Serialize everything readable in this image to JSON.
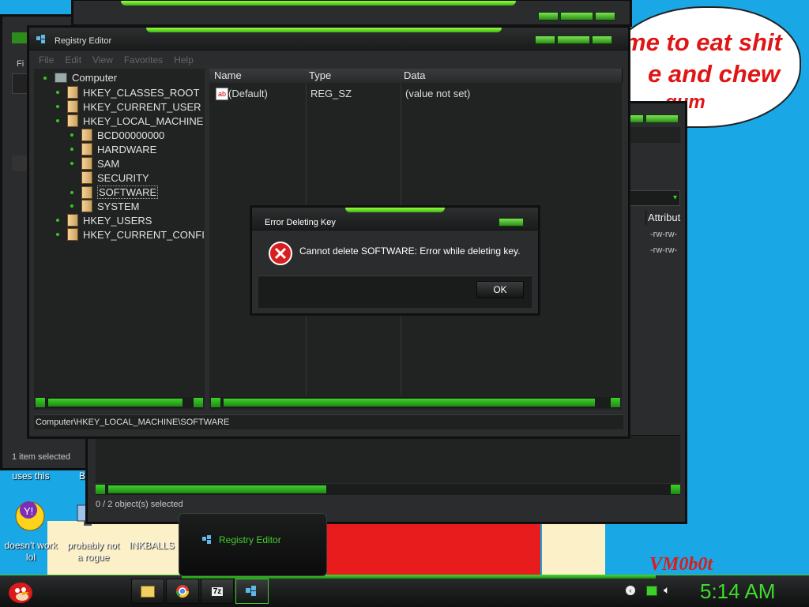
{
  "wallpaper": {
    "bubble_line1": "me to eat shit",
    "bubble_line2": "e and chew",
    "bubble_line3": "gum",
    "signature": "VM0b0t"
  },
  "desktop_icons": [
    {
      "label": "uses this"
    },
    {
      "label": "B"
    },
    {
      "label": "doesn't work lol"
    },
    {
      "label": "probably not a rogue"
    },
    {
      "label": "INKBALLS"
    }
  ],
  "back_window_left": {
    "menu_fragment": "Fi",
    "status": "1 item selected"
  },
  "back_window_right": {
    "column_attributes": "Attribut",
    "rows": [
      {
        "attributes": "-rw-rw-"
      },
      {
        "attributes": "-rw-rw-"
      }
    ],
    "status": "0 / 2 object(s) selected"
  },
  "registry": {
    "title": "Registry Editor",
    "menu": [
      "File",
      "Edit",
      "View",
      "Favorites",
      "Help"
    ],
    "tree": {
      "root": "Computer",
      "hives": [
        "HKEY_CLASSES_ROOT",
        "HKEY_CURRENT_USER",
        "HKEY_LOCAL_MACHINE",
        "HKEY_USERS",
        "HKEY_CURRENT_CONFI"
      ],
      "hklm_children": [
        "BCD00000000",
        "HARDWARE",
        "SAM",
        "SECURITY",
        "SOFTWARE",
        "SYSTEM"
      ],
      "selected": "SOFTWARE"
    },
    "columns": {
      "name": "Name",
      "type": "Type",
      "data": "Data"
    },
    "values": [
      {
        "name": "(Default)",
        "type": "REG_SZ",
        "data": "(value not set)",
        "icon": "ab-icon"
      }
    ],
    "status_path": "Computer\\HKEY_LOCAL_MACHINE\\SOFTWARE"
  },
  "dialog": {
    "title": "Error Deleting Key",
    "message": "Cannot delete SOFTWARE:  Error while deleting key.",
    "ok": "OK",
    "icon": "error-icon"
  },
  "taskbar": {
    "start_icon": "angry-bird-icon",
    "pinned": [
      {
        "icon": "folder-icon"
      },
      {
        "icon": "chrome-icon"
      },
      {
        "icon": "7zip-icon",
        "text": "7z"
      },
      {
        "icon": "registry-icon"
      }
    ],
    "preview_title": "Registry Editor",
    "clock": "5:14 AM",
    "tray": [
      "back-icon",
      "network-icon",
      "volume-icon"
    ]
  },
  "colors": {
    "accent": "#3fcf2c",
    "desktop": "#19a7e6",
    "window": "#2a2c2d"
  }
}
